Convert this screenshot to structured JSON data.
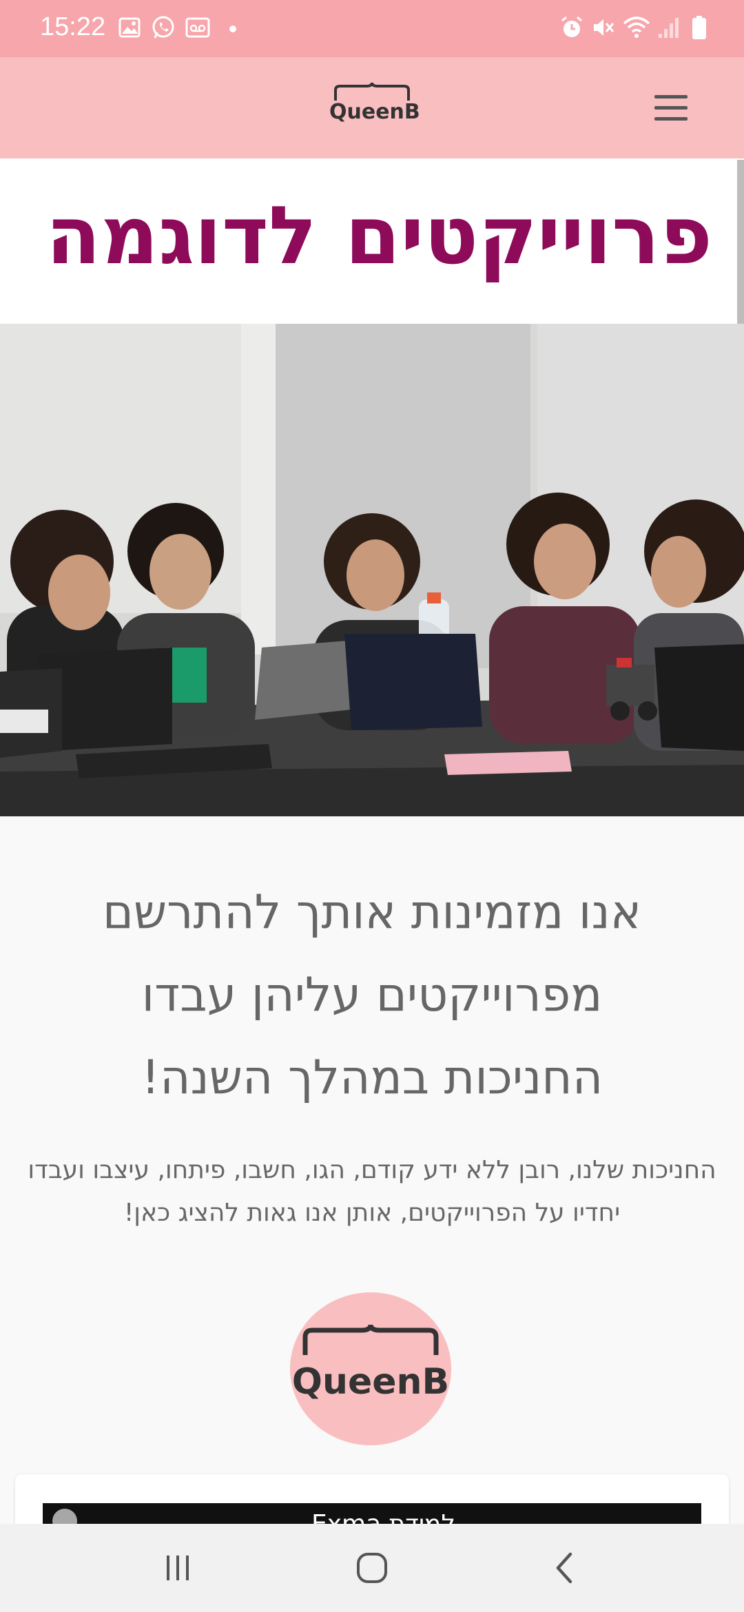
{
  "status_bar": {
    "time": "15:22",
    "left_icons": [
      "image-icon",
      "whatsapp-icon",
      "voicemail-icon"
    ],
    "right_icons": [
      "alarm-icon",
      "mute-icon",
      "wifi-icon",
      "signal-icon",
      "battery-icon"
    ]
  },
  "header": {
    "logo_text": "QueenB",
    "menu_icon": "hamburger-menu-icon"
  },
  "page": {
    "title": "פרוייקטים לדוגמה",
    "headline_lines": [
      "אנו מזמינות אותך להתרשם",
      "מפרוייקטים עליהן עבדו",
      "החניכות במהלך השנה!"
    ],
    "description": "החניכות שלנו, רובן ללא ידע קודם, הגו, חשבו, פיתחו, עיצבו ועבדו יחדיו על הפרוייקטים, אותן אנו גאות להציג כאן!",
    "circle_logo_text": "QueenB"
  },
  "video_card": {
    "title": "למידת Exma"
  },
  "colors": {
    "status_bar": "#f7a6ab",
    "header": "#f9bec0",
    "title": "#8e0b5a",
    "text": "#666666"
  },
  "nav_bar": {
    "icons": [
      "recent-apps-icon",
      "home-icon",
      "back-icon"
    ]
  }
}
